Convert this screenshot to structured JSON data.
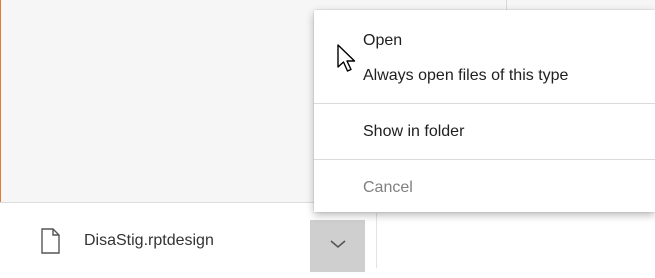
{
  "context_menu": {
    "items": [
      {
        "label": "Open",
        "enabled": true
      },
      {
        "label": "Always open files of this type",
        "enabled": true
      },
      {
        "label": "Show in folder",
        "enabled": true
      },
      {
        "label": "Cancel",
        "enabled": false
      }
    ]
  },
  "download_bar": {
    "file_name": "DisaStig.rptdesign",
    "file_icon": "document-icon",
    "menu_button_icon": "chevron-down-icon"
  },
  "colors": {
    "accent_left_edge": "#e07b39",
    "menu_button_background": "#cfcfcf",
    "disabled_text": "#808080"
  }
}
